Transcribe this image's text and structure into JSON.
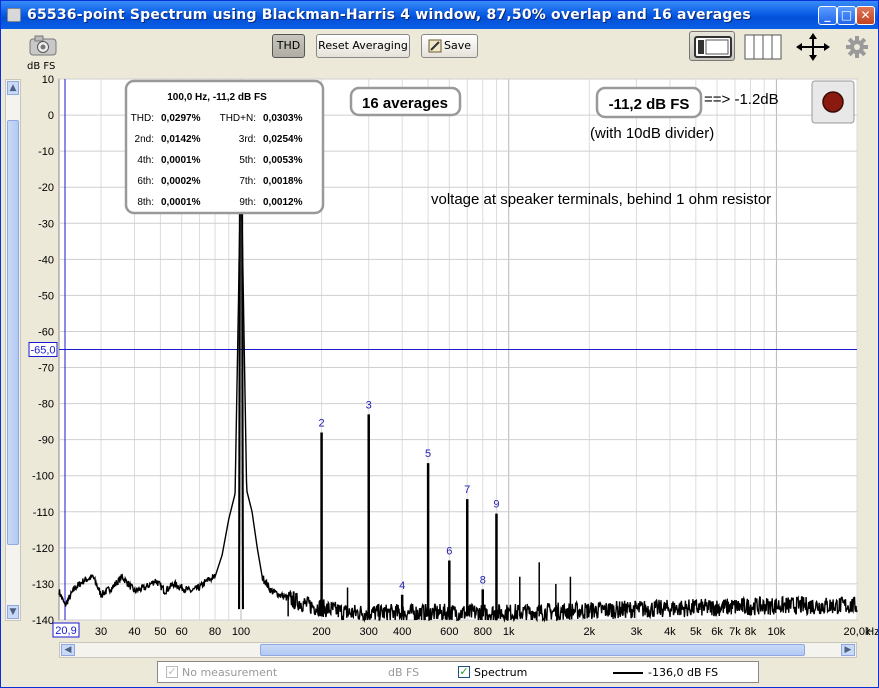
{
  "window": {
    "title": "65536-point Spectrum using Blackman-Harris 4 window, 87,50% overlap and 16 averages",
    "minimize_glyph": "_",
    "maximize_glyph": "□",
    "close_glyph": "✕"
  },
  "toolbar": {
    "camera_icon": "camera-icon",
    "thd_label": "THD",
    "reset_label": "Reset Averaging",
    "save_label": "Save",
    "settings_icon": "gear-icon"
  },
  "plot": {
    "y_unit": "dB FS",
    "x_unit": "Hz",
    "x_start_label": "20,9",
    "marker_label": "-65,0",
    "y_ticks": [
      10,
      0,
      -10,
      -20,
      -30,
      -40,
      -50,
      -60,
      -70,
      -80,
      -90,
      -100,
      -110,
      -120,
      -130,
      -140
    ],
    "y_tick_labels": [
      "10",
      "0",
      "-10",
      "-20",
      "-30",
      "-40",
      "-50",
      "-60",
      "-70",
      "-80",
      "-90",
      "-100",
      "-110",
      "-120",
      "-130",
      "-140"
    ],
    "x_ticks": [
      30,
      40,
      50,
      60,
      80,
      100,
      200,
      300,
      400,
      600,
      800,
      1000,
      2000,
      3000,
      4000,
      5000,
      6000,
      7000,
      8000,
      10000,
      20000
    ],
    "x_tick_labels": [
      "30",
      "40",
      "50",
      "60",
      "80",
      "100",
      "200",
      "300",
      "400",
      "600",
      "800",
      "1k",
      "2k",
      "3k",
      "4k",
      "5k",
      "6k",
      "7k",
      "8k",
      "10k",
      "20,0k"
    ]
  },
  "thd_box": {
    "header": "100,0 Hz, -11,2 dB FS",
    "rows": [
      {
        "l1": "THD:",
        "v1": "0,0297%",
        "l2": "THD+N:",
        "v2": "0,0303%"
      },
      {
        "l1": "2nd:",
        "v1": "0,0142%",
        "l2": "3rd:",
        "v2": "0,0254%"
      },
      {
        "l1": "4th:",
        "v1": "0,0001%",
        "l2": "5th:",
        "v2": "0,0053%"
      },
      {
        "l1": "6th:",
        "v1": "0,0002%",
        "l2": "7th:",
        "v2": "0,0018%"
      },
      {
        "l1": "8th:",
        "v1": "0,0001%",
        "l2": "9th:",
        "v2": "0,0012%"
      }
    ]
  },
  "annotations": {
    "averages": "16 averages",
    "level": "-11,2 dB FS",
    "arrow_text": "==> -1.2dB",
    "divider": "(with 10dB divider)",
    "note": "voltage at speaker terminals, behind 1 ohm resistor"
  },
  "legend": {
    "no_measurement": "No measurement",
    "dbfs": "dB FS",
    "spectrum": "Spectrum",
    "spectrum_value": "-136,0 dB FS"
  },
  "colors": {
    "harmonic_label": "#2020b0",
    "marker_line": "#1a1ad0",
    "trace": "#000000",
    "grid": "#cfcfcf"
  },
  "chart_data": {
    "type": "line",
    "xscale": "log",
    "xlim": [
      20.9,
      20000
    ],
    "ylim": [
      -140,
      10
    ],
    "fundamental": {
      "freq": 100,
      "level": -11.2
    },
    "harmonics": [
      {
        "label": "2",
        "freq": 200,
        "level": -88
      },
      {
        "label": "3",
        "freq": 300,
        "level": -83
      },
      {
        "label": "4",
        "freq": 400,
        "level": -133
      },
      {
        "label": "5",
        "freq": 500,
        "level": -96.5
      },
      {
        "label": "6",
        "freq": 600,
        "level": -123.5
      },
      {
        "label": "7",
        "freq": 700,
        "level": -106.5
      },
      {
        "label": "8",
        "freq": 800,
        "level": -131.5
      },
      {
        "label": "9",
        "freq": 900,
        "level": -110.5
      }
    ],
    "extra_peaks": [
      {
        "freq": 150,
        "level": -133
      },
      {
        "freq": 250,
        "level": -131
      },
      {
        "freq": 1100,
        "level": -128
      },
      {
        "freq": 1300,
        "level": -124
      },
      {
        "freq": 1500,
        "level": -130
      },
      {
        "freq": 1700,
        "level": -128
      }
    ],
    "noise_floor": [
      [
        20.9,
        -132
      ],
      [
        22,
        -136
      ],
      [
        24,
        -131
      ],
      [
        26,
        -129
      ],
      [
        28,
        -128
      ],
      [
        30,
        -133
      ],
      [
        33,
        -131
      ],
      [
        36,
        -128
      ],
      [
        40,
        -132
      ],
      [
        44,
        -131
      ],
      [
        48,
        -129
      ],
      [
        52,
        -132
      ],
      [
        56,
        -130
      ],
      [
        60,
        -131
      ],
      [
        65,
        -132
      ],
      [
        70,
        -131
      ],
      [
        75,
        -129
      ],
      [
        80,
        -128
      ],
      [
        85,
        -122
      ],
      [
        90,
        -112
      ],
      [
        95,
        -105
      ],
      [
        100,
        -11.2
      ],
      [
        105,
        -104
      ],
      [
        110,
        -110
      ],
      [
        115,
        -120
      ],
      [
        120,
        -128
      ],
      [
        130,
        -132
      ],
      [
        150,
        -134
      ],
      [
        180,
        -136
      ],
      [
        250,
        -138
      ],
      [
        400,
        -138
      ],
      [
        1000,
        -138
      ],
      [
        3000,
        -137
      ],
      [
        6000,
        -136.5
      ],
      [
        10000,
        -136
      ],
      [
        20000,
        -136
      ]
    ],
    "marker_level": -65
  }
}
